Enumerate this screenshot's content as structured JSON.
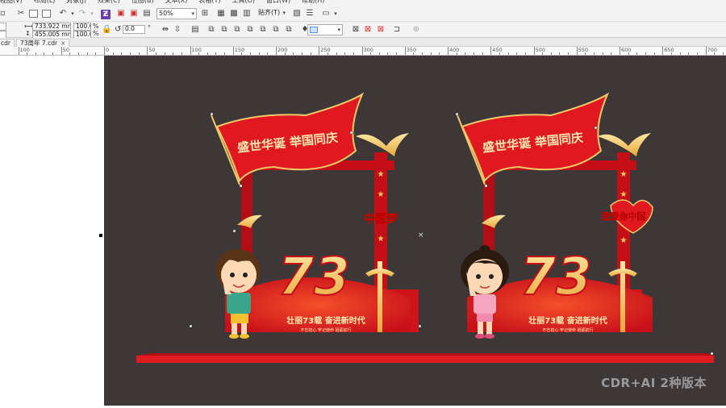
{
  "menu": {
    "items": [
      "视图(V)",
      "布局(L)",
      "对象(J)",
      "效果(C)",
      "位图(B)",
      "文本(X)",
      "表格(T)",
      "工具(O)",
      "窗口(W)",
      "帮助(H)"
    ]
  },
  "toolbar": {
    "zoom_value": "50%",
    "snap_label": "贴齐(T)"
  },
  "property_bar": {
    "width_value": "733.922 mm",
    "height_value": "455.005 mm",
    "scale_x": "100.0",
    "scale_y": "100.0",
    "percent_sign": "%",
    "rotation_value": "0.0",
    "degree_sign": "°"
  },
  "tabs": [
    {
      "label": "cdr"
    },
    {
      "label": "73周年 7.cdr"
    }
  ],
  "ruler": {
    "labels": [
      "100",
      "50",
      "0",
      "50",
      "100",
      "150",
      "200",
      "250",
      "300",
      "350",
      "400",
      "450",
      "500",
      "550",
      "600",
      "650",
      "700"
    ]
  },
  "artwork": {
    "flag_text": "盛世华诞 举国同庆",
    "left_badge": "中国梦",
    "right_badge": "我爱你中国",
    "big_number": "73",
    "slogan_main": "壮丽73载 奋进新时代",
    "slogan_sub": "不忘初心 牢记使命 砥砺前行"
  },
  "watermark": "CDR+AI 2种版本",
  "colors": {
    "canvas_bg": "#3d3837",
    "red": "#d8141c",
    "dark_red": "#a60e14",
    "gold": "#f2c96a"
  }
}
